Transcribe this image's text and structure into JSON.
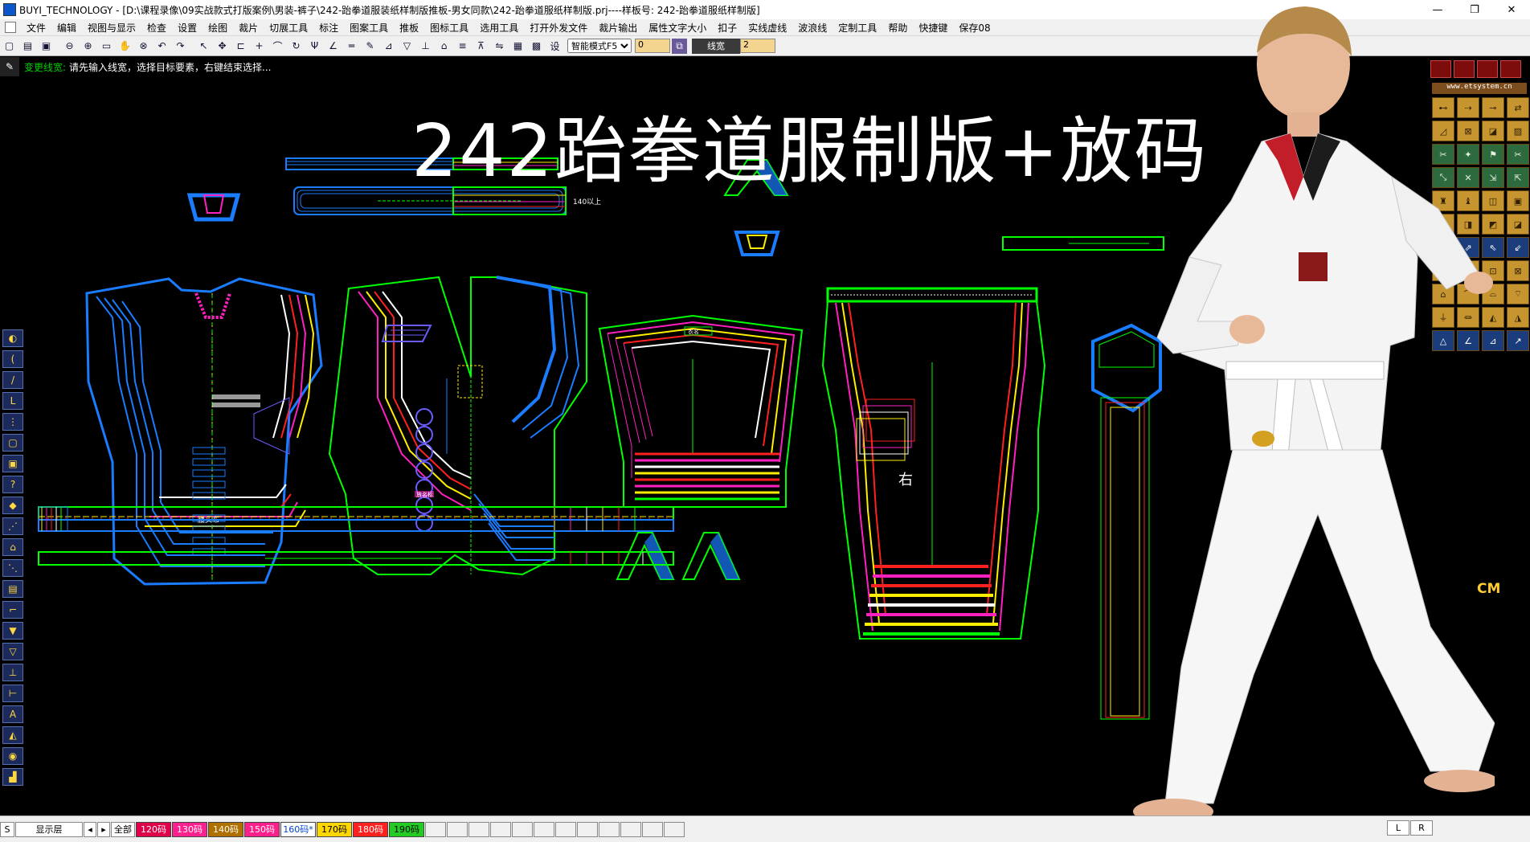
{
  "window": {
    "title": "BUYI_TECHNOLOGY - [D:\\课程录像\\09实战款式打版案例\\男装-裤子\\242-跆拳道服装纸样制版推板-男女同款\\242-跆拳道服纸样制版.prj----样板号: 242-跆拳道服纸样制版]",
    "min": "—",
    "max": "❐",
    "close": "✕"
  },
  "menu": [
    "文件",
    "编辑",
    "视图与显示",
    "检查",
    "设置",
    "绘图",
    "裁片",
    "切展工具",
    "标注",
    "图案工具",
    "推板",
    "图标工具",
    "选用工具",
    "打开外发文件",
    "裁片输出",
    "属性文字大小",
    "扣子",
    "实线虚线",
    "波浪线",
    "定制工具",
    "帮助",
    "快捷键",
    "保存08"
  ],
  "toolbar": {
    "settings_label": "设",
    "mode": "智能模式F5",
    "mode_value": "0",
    "line_width_label": "线宽",
    "line_width_value": "2"
  },
  "prompt": {
    "label": "变更线宽:",
    "text": "请先输入线宽，选择目标要素，右键结束选择..."
  },
  "canvas": {
    "headline": "242跆拳道服制版+放码",
    "labels": {
      "pants_right": "右",
      "side_tag": "140以上",
      "collar_tag": "腰头布",
      "front_tag": "衣名",
      "pocket_tag": "放名标"
    }
  },
  "right_panel": {
    "url": "www.etsystem.cn",
    "cm_label": "CM"
  },
  "bottom": {
    "layer_label": "S",
    "display_layer": "显示层",
    "all": "全部",
    "sizes": [
      {
        "label": "120码",
        "color": "#e0004a"
      },
      {
        "label": "130码",
        "color": "#ff2090"
      },
      {
        "label": "140码",
        "color": "#b07000"
      },
      {
        "label": "150码",
        "color": "#ff1f8c"
      },
      {
        "label": "160码*",
        "color": "#ffffff"
      },
      {
        "label": "170码",
        "color": "#ffd700"
      },
      {
        "label": "180码",
        "color": "#ff2020"
      },
      {
        "label": "190码",
        "color": "#22cc22"
      }
    ],
    "left_btn": "L",
    "right_btn": "R"
  },
  "colors": {
    "green": "#00ff00",
    "blue": "#1a7cff",
    "red": "#ff2020",
    "magenta": "#ff20c0",
    "yellow": "#ffee00",
    "white": "#ffffff"
  }
}
